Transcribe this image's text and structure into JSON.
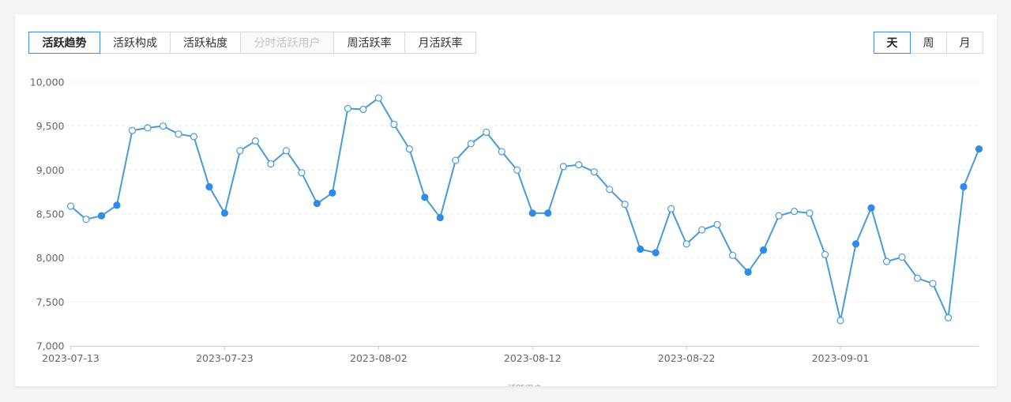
{
  "tabs": {
    "items": [
      "活跃趋势",
      "活跃构成",
      "活跃粘度",
      "分时活跃用户",
      "周活跃率",
      "月活跃率"
    ],
    "active": "活跃趋势",
    "disabled": "分时活跃用户"
  },
  "period": {
    "items": [
      "天",
      "周",
      "月"
    ],
    "active": "天"
  },
  "chart_data": {
    "type": "line",
    "xlabel": "活跃用户",
    "ylim": [
      7000,
      10000
    ],
    "y_ticks": [
      "7,000",
      "7,500",
      "8,000",
      "8,500",
      "9,000",
      "9,500",
      "10,000"
    ],
    "x_ticks": [
      "2023-07-13",
      "2023-07-23",
      "2023-08-02",
      "2023-08-12",
      "2023-08-22",
      "2023-09-01"
    ],
    "grid": "horizontal dashed",
    "line_color": "#4a9bd4",
    "point_fill_hollow": "#ffffff",
    "point_fill_solid": "#2f8be6",
    "x": [
      "2023-07-13",
      "2023-07-14",
      "2023-07-15",
      "2023-07-16",
      "2023-07-17",
      "2023-07-18",
      "2023-07-19",
      "2023-07-20",
      "2023-07-21",
      "2023-07-22",
      "2023-07-23",
      "2023-07-24",
      "2023-07-25",
      "2023-07-26",
      "2023-07-27",
      "2023-07-28",
      "2023-07-29",
      "2023-07-30",
      "2023-07-31",
      "2023-08-01",
      "2023-08-02",
      "2023-08-03",
      "2023-08-04",
      "2023-08-05",
      "2023-08-06",
      "2023-08-07",
      "2023-08-08",
      "2023-08-09",
      "2023-08-10",
      "2023-08-11",
      "2023-08-12",
      "2023-08-13",
      "2023-08-14",
      "2023-08-15",
      "2023-08-16",
      "2023-08-17",
      "2023-08-18",
      "2023-08-19",
      "2023-08-20",
      "2023-08-21",
      "2023-08-22",
      "2023-08-23",
      "2023-08-24",
      "2023-08-25",
      "2023-08-26",
      "2023-08-27",
      "2023-08-28",
      "2023-08-29",
      "2023-08-30",
      "2023-08-31",
      "2023-09-01",
      "2023-09-02",
      "2023-09-03",
      "2023-09-04",
      "2023-09-05",
      "2023-09-06",
      "2023-09-07",
      "2023-09-08",
      "2023-09-09",
      "2023-09-10"
    ],
    "values": [
      8590,
      8440,
      8480,
      8600,
      9450,
      9480,
      9500,
      9410,
      9380,
      8810,
      8510,
      9220,
      9330,
      9070,
      9220,
      8970,
      8620,
      8740,
      9700,
      9690,
      9820,
      9520,
      9240,
      8690,
      8460,
      9110,
      9300,
      9430,
      9210,
      9000,
      8510,
      8510,
      9040,
      9060,
      8980,
      8780,
      8610,
      8100,
      8060,
      8560,
      8160,
      8320,
      8380,
      8030,
      7840,
      8090,
      8480,
      8530,
      8510,
      8040,
      7290,
      8160,
      8570,
      7960,
      8010,
      7770,
      7710,
      7320,
      8810,
      9240
    ],
    "solid_points": [
      2,
      3,
      9,
      10,
      16,
      17,
      23,
      24,
      30,
      31,
      37,
      38,
      44,
      45,
      51,
      52,
      58,
      59
    ]
  }
}
